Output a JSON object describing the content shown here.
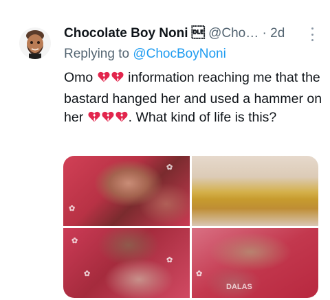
{
  "tweet": {
    "display_name": "Chocolate Boy Noni",
    "name_glyph": "\u0010",
    "handle": "@Cho…",
    "separator": "·",
    "time": "2d",
    "replying_prefix": "Replying to",
    "replying_to": "@ChocBoyNoni",
    "text_part1": "Omo",
    "text_part2": "information reaching me that the bastard hanged her and used a hammer on her",
    "text_part3": ". What kind of life is this?",
    "emoji_icon": "broken-heart-icon",
    "media_count": 4,
    "media_watermark": "DALAS"
  },
  "colors": {
    "link": "#1d9bf0",
    "secondary": "#536471",
    "primary": "#0f1419",
    "heart": "#e2264d"
  }
}
